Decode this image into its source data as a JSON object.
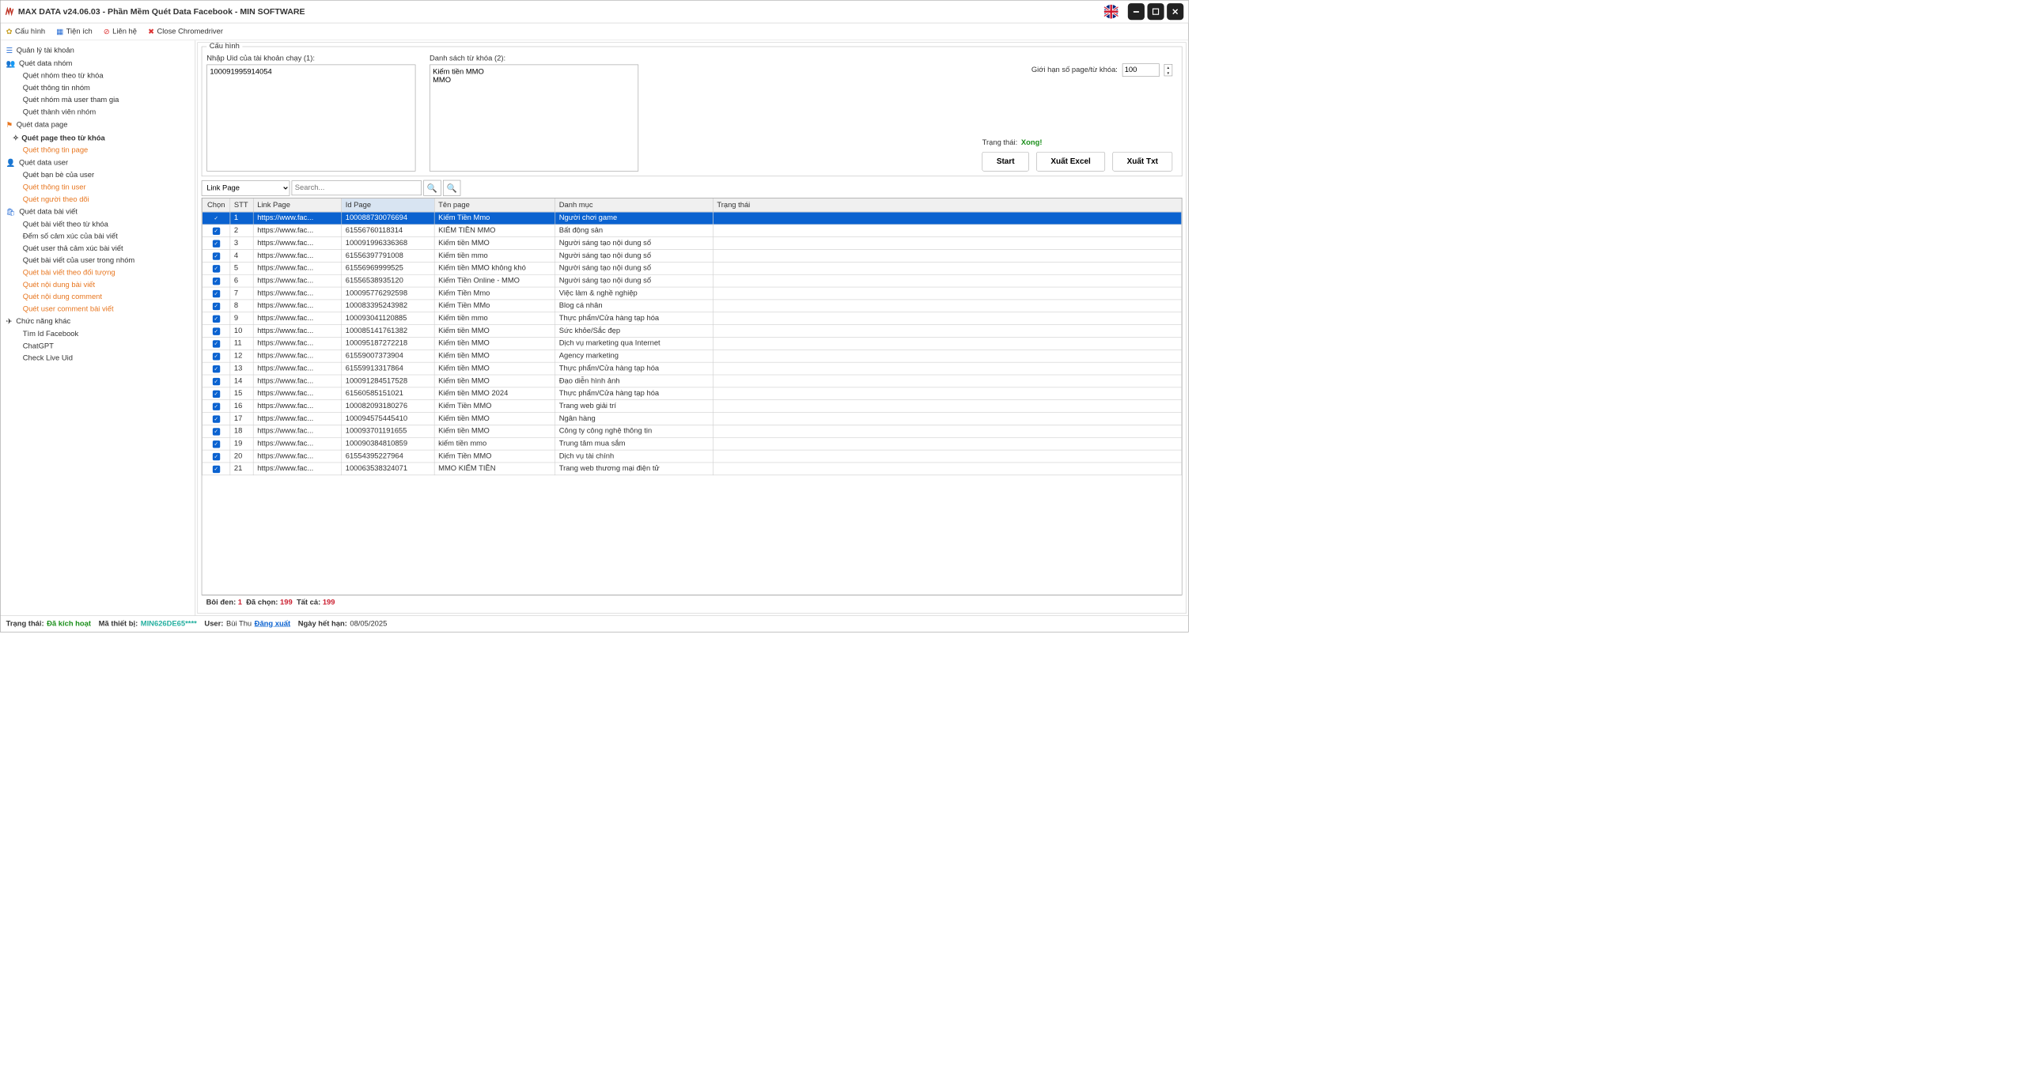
{
  "title": "MAX DATA v24.06.03 - Phần Mềm Quét Data Facebook - MIN SOFTWARE",
  "toolbar": {
    "config": "Cấu hình",
    "util": "Tiện ích",
    "contact": "Liên hệ",
    "close_driver": "Close Chromedriver"
  },
  "sidebar": {
    "accounts": "Quản lý tài khoản",
    "group_data": "Quét data nhóm",
    "group_keyword": "Quét nhóm theo từ khóa",
    "group_info": "Quét thông tin nhóm",
    "group_user": "Quét nhóm mà user tham gia",
    "group_members": "Quét thành viên nhóm",
    "page_data": "Quét data page",
    "page_keyword": "Quét page theo từ khóa",
    "page_info": "Quét thông tin page",
    "user_data": "Quét data user",
    "user_friends": "Quét bạn bè của user",
    "user_info": "Quét thông tin user",
    "user_followers": "Quét người theo dõi",
    "post_data": "Quét data bài viết",
    "post_keyword": "Quét bài viết theo từ khóa",
    "post_reactions": "Đếm số cảm xúc của bài viết",
    "post_react_users": "Quét user thả cảm xúc bài viết",
    "post_user_group": "Quét bài viết của user trong nhóm",
    "post_by_target": "Quét bài viết theo đối tượng",
    "post_content": "Quét nội dung bài viết",
    "comment_content": "Quét nội dung comment",
    "comment_users": "Quét user comment bài viết",
    "other": "Chức năng khác",
    "find_id": "Tìm Id Facebook",
    "chatgpt": "ChatGPT",
    "check_uid": "Check Live Uid"
  },
  "config": {
    "legend": "Cấu hình",
    "uid_label": "Nhập Uid của tài khoản chạy (1):",
    "uid_value": "100091995914054",
    "keyword_label": "Danh sách từ khóa (2):",
    "keyword_value": "Kiếm tiền MMO\nMMO",
    "limit_label": "Giới hạn số page/từ khóa:",
    "limit_value": "100",
    "status_label": "Trạng thái:",
    "status_value": "Xong!",
    "start": "Start",
    "export_excel": "Xuất Excel",
    "export_txt": "Xuất Txt"
  },
  "search": {
    "type": "Link Page",
    "placeholder": "Search..."
  },
  "columns": {
    "chon": "Chọn",
    "stt": "STT",
    "link": "Link Page",
    "id": "Id Page",
    "ten": "Tên page",
    "dm": "Danh mục",
    "tt": "Trạng thái"
  },
  "rows": [
    {
      "stt": "1",
      "link": "https://www.fac...",
      "id": "100088730076694",
      "ten": "Kiếm Tiền Mmo",
      "dm": "Người chơi game",
      "selected": true
    },
    {
      "stt": "2",
      "link": "https://www.fac...",
      "id": "61556760118314",
      "ten": "KIẾM TIỀN MMO",
      "dm": "Bất động sản"
    },
    {
      "stt": "3",
      "link": "https://www.fac...",
      "id": "100091996336368",
      "ten": "Kiếm tiền MMO",
      "dm": "Người sáng tạo nội dung số"
    },
    {
      "stt": "4",
      "link": "https://www.fac...",
      "id": "61556397791008",
      "ten": "Kiếm tiền mmo",
      "dm": "Người sáng tạo nội dung số"
    },
    {
      "stt": "5",
      "link": "https://www.fac...",
      "id": "61556969999525",
      "ten": "Kiếm tiền MMO không khó",
      "dm": "Người sáng tạo nội dung số"
    },
    {
      "stt": "6",
      "link": "https://www.fac...",
      "id": "61556538935120",
      "ten": "Kiếm Tiền Online - MMO",
      "dm": "Người sáng tạo nội dung số"
    },
    {
      "stt": "7",
      "link": "https://www.fac...",
      "id": "100095776292598",
      "ten": "Kiếm Tiền Mmo",
      "dm": "Việc làm & nghề nghiệp"
    },
    {
      "stt": "8",
      "link": "https://www.fac...",
      "id": "100083395243982",
      "ten": "Kiếm Tiền MMo",
      "dm": "Blog cá nhân"
    },
    {
      "stt": "9",
      "link": "https://www.fac...",
      "id": "100093041120885",
      "ten": "Kiếm tiền mmo",
      "dm": "Thực phẩm/Cửa hàng tạp hóa"
    },
    {
      "stt": "10",
      "link": "https://www.fac...",
      "id": "100085141761382",
      "ten": "Kiếm tiền MMO",
      "dm": "Sức khỏe/Sắc đẹp"
    },
    {
      "stt": "11",
      "link": "https://www.fac...",
      "id": "100095187272218",
      "ten": "Kiếm tiền MMO",
      "dm": "Dịch vụ marketing qua Internet"
    },
    {
      "stt": "12",
      "link": "https://www.fac...",
      "id": "61559007373904",
      "ten": "Kiếm tiền MMO",
      "dm": "Agency marketing"
    },
    {
      "stt": "13",
      "link": "https://www.fac...",
      "id": "61559913317864",
      "ten": "Kiếm tiền MMO",
      "dm": "Thực phẩm/Cửa hàng tạp hóa"
    },
    {
      "stt": "14",
      "link": "https://www.fac...",
      "id": "100091284517528",
      "ten": "Kiếm tiền MMO",
      "dm": "Đạo diễn hình ảnh"
    },
    {
      "stt": "15",
      "link": "https://www.fac...",
      "id": "61560585151021",
      "ten": "Kiếm tiền MMO 2024",
      "dm": "Thực phẩm/Cửa hàng tạp hóa"
    },
    {
      "stt": "16",
      "link": "https://www.fac...",
      "id": "100082093180276",
      "ten": "Kiếm Tiền MMO",
      "dm": "Trang web giải trí"
    },
    {
      "stt": "17",
      "link": "https://www.fac...",
      "id": "100094575445410",
      "ten": "Kiếm tiền MMO",
      "dm": "Ngân hàng"
    },
    {
      "stt": "18",
      "link": "https://www.fac...",
      "id": "100093701191655",
      "ten": "Kiếm tiền MMO",
      "dm": "Công ty công nghệ thông tin"
    },
    {
      "stt": "19",
      "link": "https://www.fac...",
      "id": "100090384810859",
      "ten": "kiếm tiền mmo",
      "dm": "Trung tâm mua sắm"
    },
    {
      "stt": "20",
      "link": "https://www.fac...",
      "id": "61554395227964",
      "ten": "Kiếm Tiền MMO",
      "dm": "Dịch vụ tài chính"
    },
    {
      "stt": "21",
      "link": "https://www.fac...",
      "id": "100063538324071",
      "ten": "MMO KIẾM TIỀN",
      "dm": "Trang web thương mại điện tử"
    }
  ],
  "summary": {
    "boi_den_label": "Bôi đen:",
    "boi_den": "1",
    "da_chon_label": "Đã chọn:",
    "da_chon": "199",
    "tat_ca_label": "Tất cả:",
    "tat_ca": "199"
  },
  "statusbar": {
    "status_label": "Trạng thái:",
    "status": "Đã kích hoạt",
    "device_label": "Mã thiết bị:",
    "device": "MIN626DE65****",
    "user_label": "User:",
    "user": "Bùi Thu",
    "logout": "Đăng xuất",
    "expire_label": "Ngày hết hạn:",
    "expire": "08/05/2025"
  }
}
